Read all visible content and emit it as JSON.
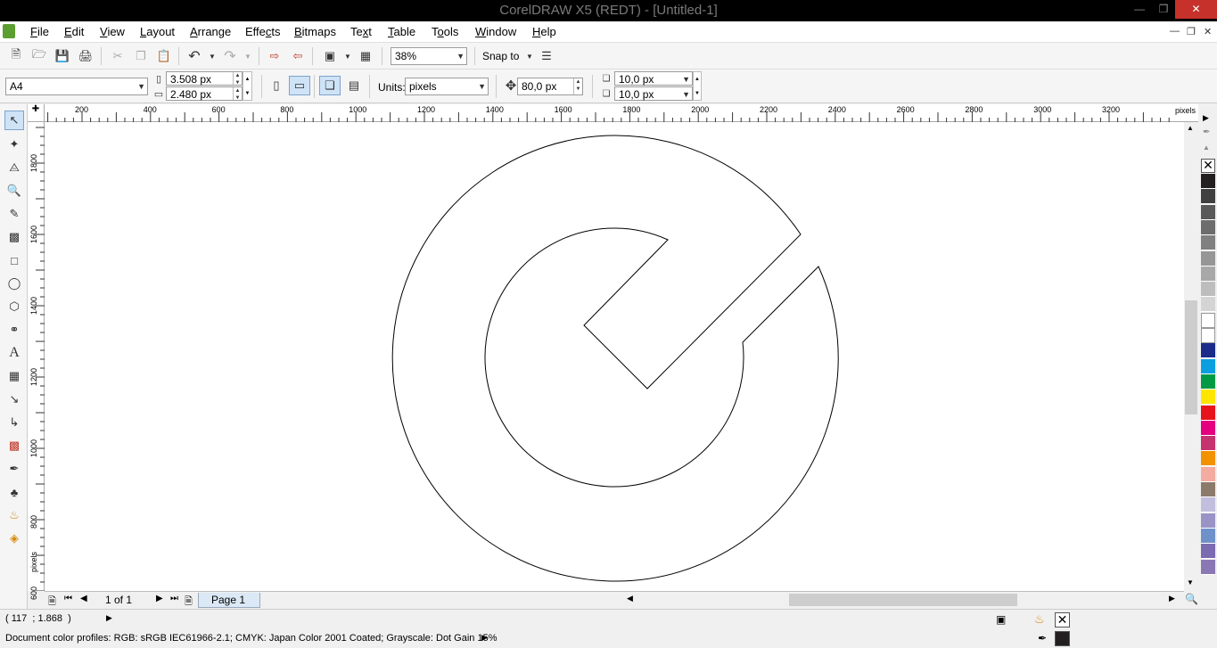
{
  "window": {
    "title": "CorelDRAW X5 (REDT) - [Untitled-1]"
  },
  "menu": [
    "File",
    "Edit",
    "View",
    "Layout",
    "Arrange",
    "Effects",
    "Bitmaps",
    "Text",
    "Table",
    "Tools",
    "Window",
    "Help"
  ],
  "menu_access": [
    "F",
    "E",
    "V",
    "L",
    "A",
    "c",
    "B",
    "x",
    "T",
    "o",
    "W",
    "H"
  ],
  "toolbar": {
    "zoom": "38%",
    "snap_to": "Snap to"
  },
  "property_bar": {
    "page_size": "A4",
    "width": "3.508 px",
    "height": "2.480 px",
    "units_label": "Units:",
    "units": "pixels",
    "nudge": "80,0 px",
    "dup_x": "10,0 px",
    "dup_y": "10,0 px"
  },
  "rulers": {
    "unit": "pixels",
    "h_ticks": [
      "200",
      "400",
      "600",
      "800",
      "1000",
      "1200",
      "1400",
      "1600",
      "1800",
      "2000",
      "2200",
      "2400",
      "2600",
      "2800",
      "3000",
      "3200"
    ],
    "v_ticks": [
      "1800",
      "1600",
      "1400",
      "1200",
      "1000",
      "800",
      "600"
    ]
  },
  "pager": {
    "count": "1 of 1",
    "tab": "Page 1"
  },
  "status": {
    "coords": "( 117  ; 1.868  )",
    "profile": "Document color profiles: RGB: sRGB IEC61966-2.1; CMYK: Japan Color 2001 Coated; Grayscale: Dot Gain 15%"
  },
  "palette": {
    "colors": [
      "#231f20",
      "#404040",
      "#595959",
      "#6d6d6d",
      "#808080",
      "#969696",
      "#a8a8a8",
      "#bdbdbd",
      "#d4d4d4",
      "#ffffff",
      "#ffffff",
      "#1b2b8a",
      "#0b9fe0",
      "#009a44",
      "#ffe600",
      "#e8141b",
      "#e5007e",
      "#c5336f",
      "#f39200",
      "#f4aba0",
      "#8c7b6b",
      "#c2bedd",
      "#9a93c6",
      "#6f91c9",
      "#7b6bb0",
      "#8a78b5"
    ]
  }
}
